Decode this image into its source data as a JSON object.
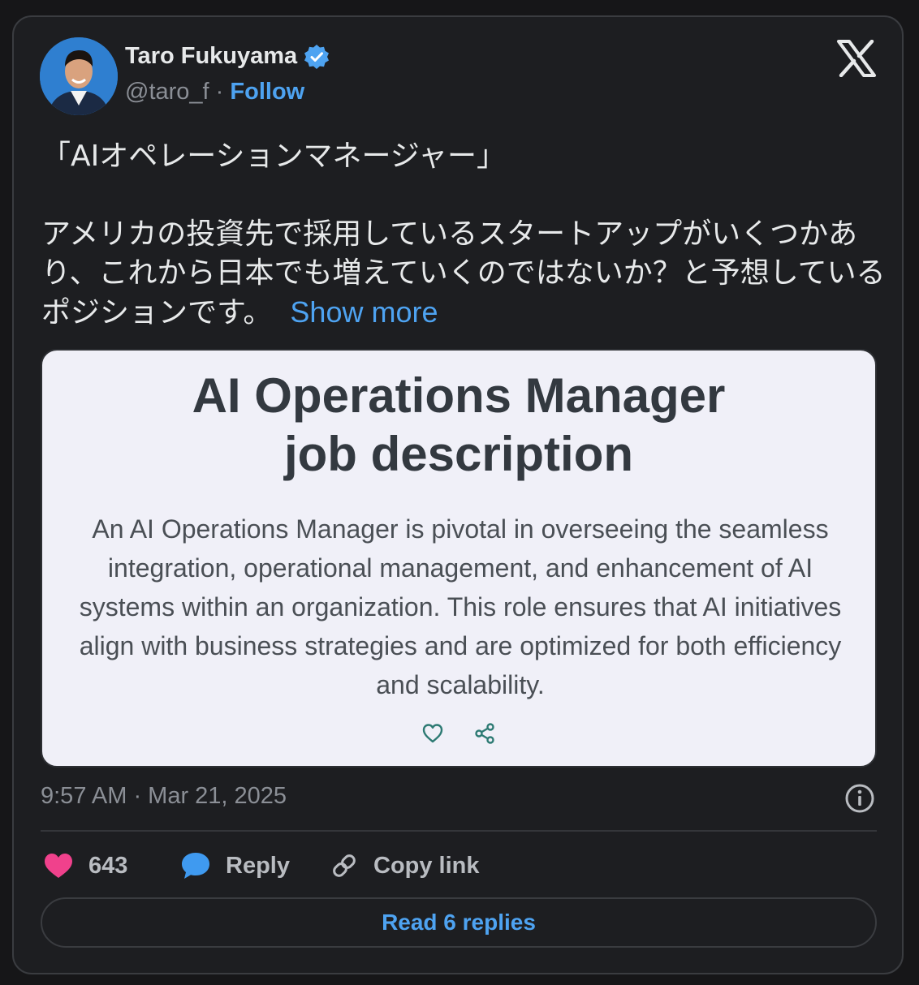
{
  "author": {
    "name": "Taro Fukuyama",
    "handle": "@taro_f",
    "separator": "·",
    "follow_label": "Follow"
  },
  "tweet": {
    "line1": "「AIオペレーションマネージャー」",
    "line2": "アメリカの投資先で採用しているスタートアップがいくつかあり、これから日本でも増えていくのではないか？と予想しているポジションです。",
    "show_more": "Show more"
  },
  "media": {
    "title_line1": "AI Operations Manager",
    "title_line2": "job description",
    "body": "An AI Operations Manager is pivotal in overseeing the seamless integration, operational management, and enhancement of AI systems within an organization. This role ensures that AI initiatives align with business strategies and are optimized for both efficiency and scalability."
  },
  "meta": {
    "timestamp": "9:57 AM · Mar 21, 2025"
  },
  "actions": {
    "like_count": "643",
    "reply_label": "Reply",
    "copy_link_label": "Copy link"
  },
  "read_replies_label": "Read 6 replies",
  "colors": {
    "accent_blue": "#4ea3f1",
    "like_pink": "#f0418c",
    "card_bg": "#1d1e21",
    "media_bg": "#f0f0f8"
  }
}
